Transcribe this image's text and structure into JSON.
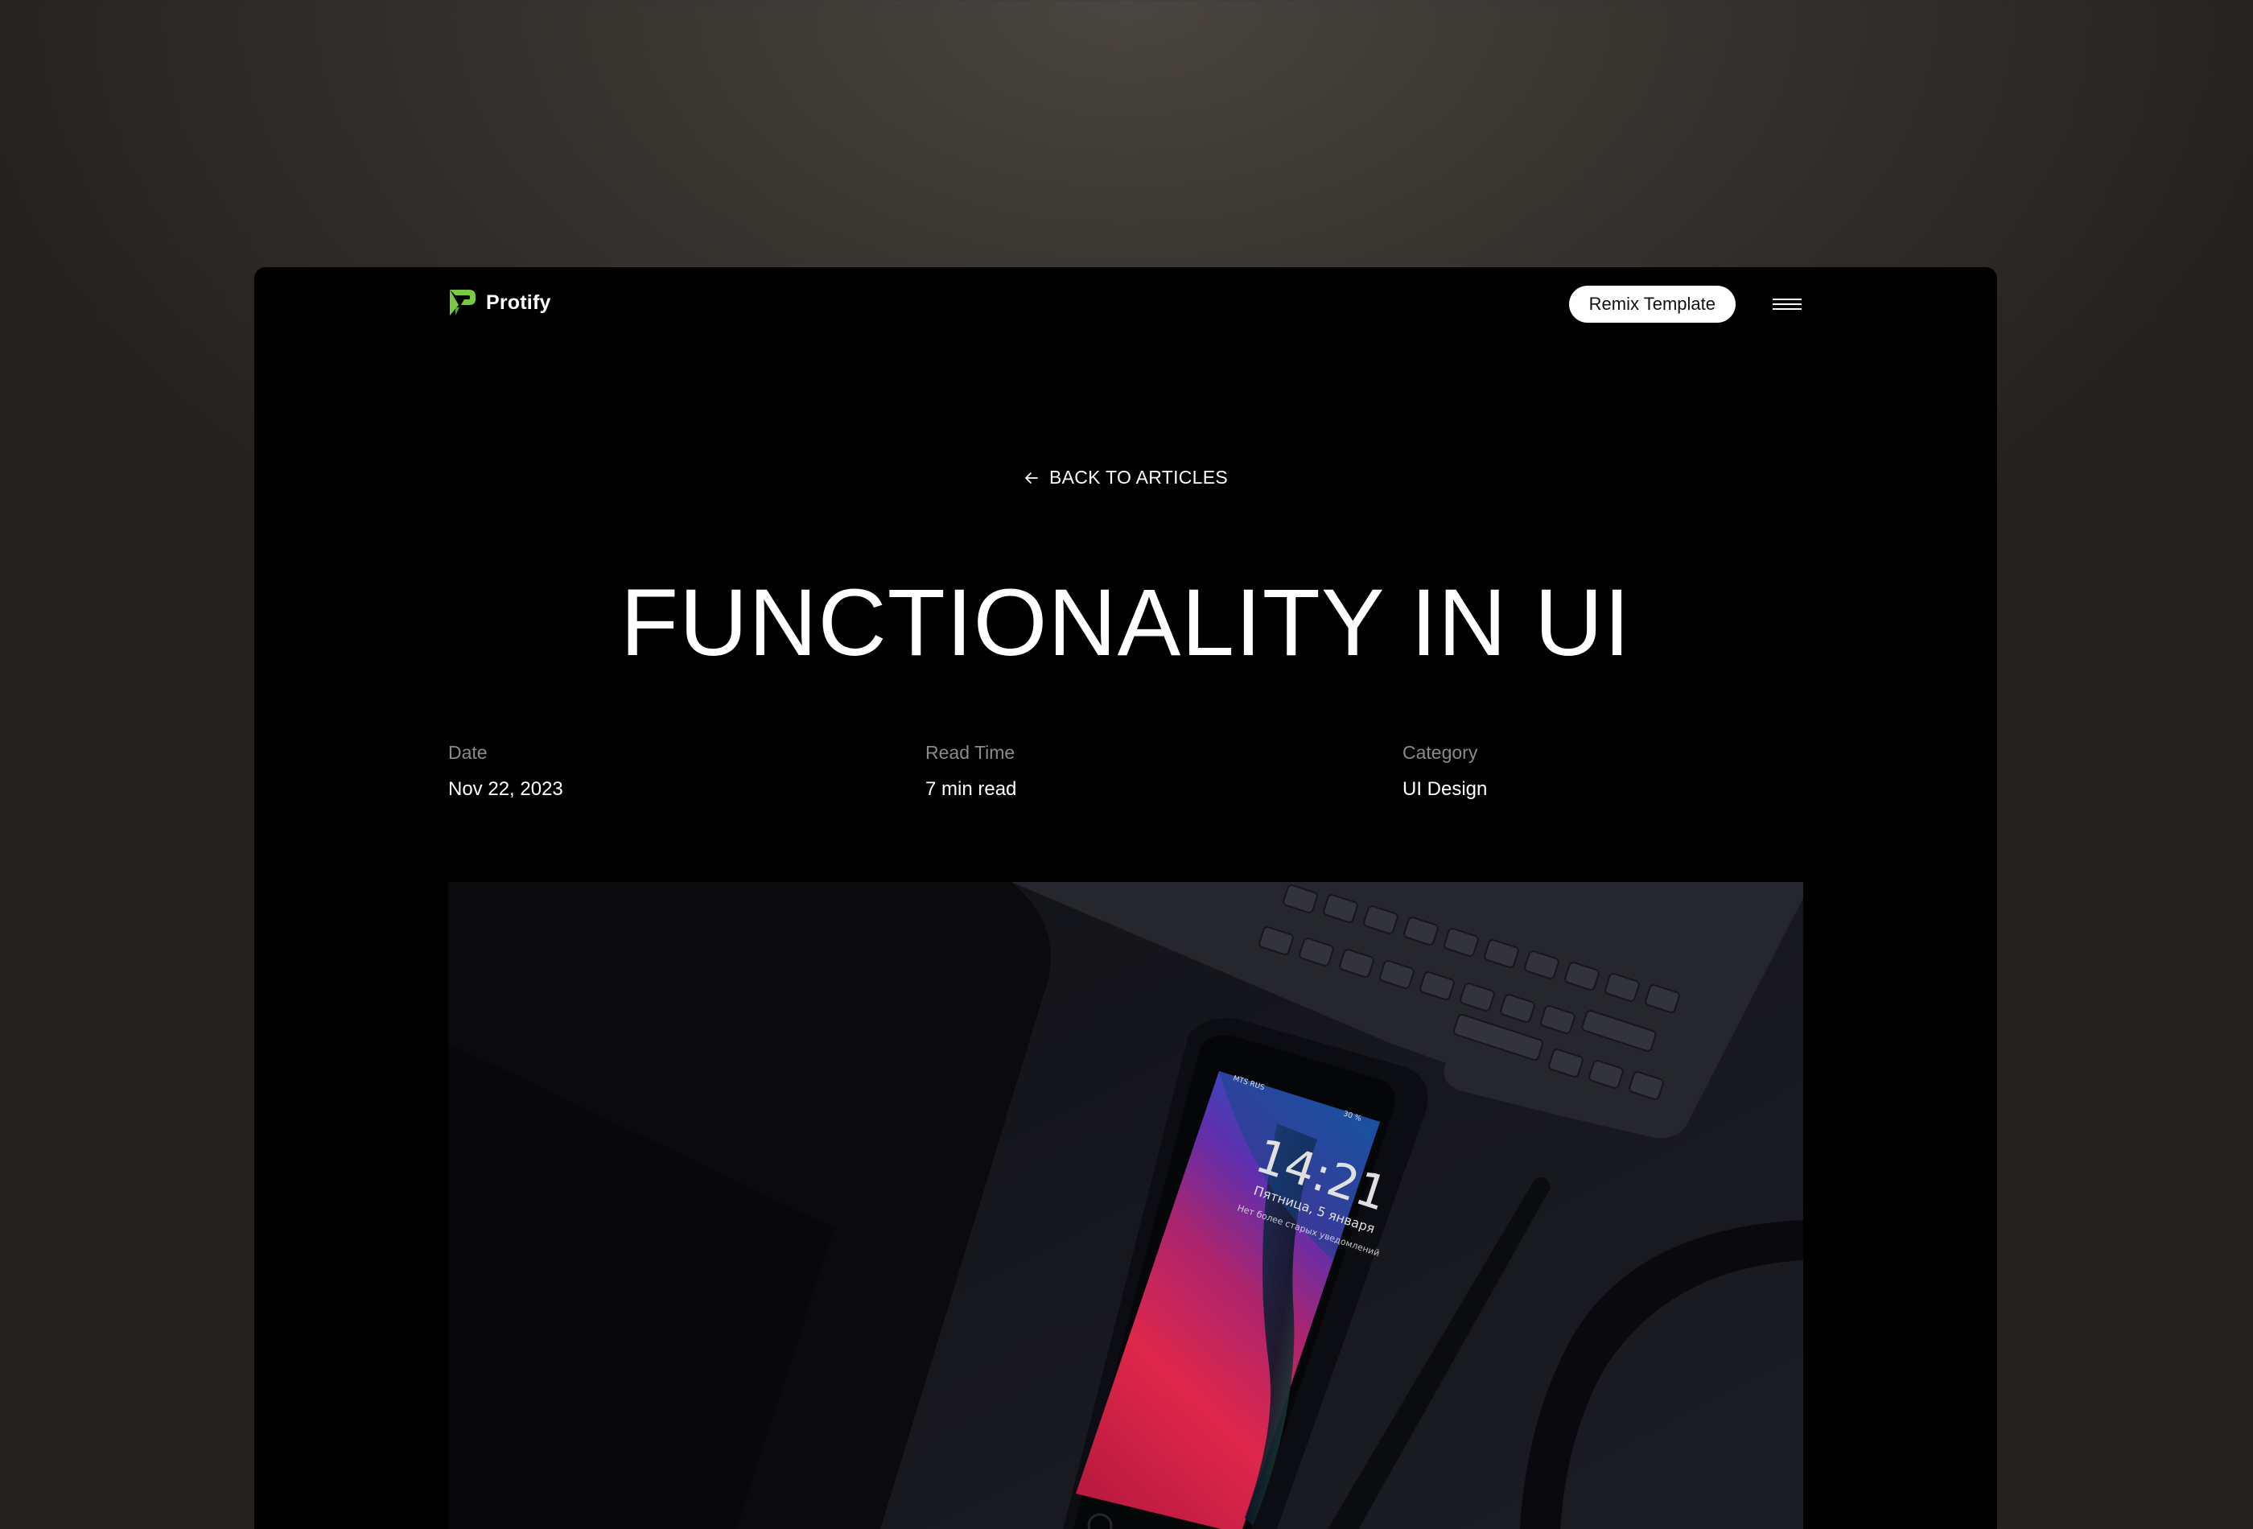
{
  "brand": {
    "name": "Protify",
    "accent": "#7ac943"
  },
  "nav": {
    "cta_label": "Remix Template",
    "menu_icon": "hamburger-icon"
  },
  "article": {
    "back_label": "BACK TO ARTICLES",
    "back_icon": "arrow-left-icon",
    "title": "FUNCTIONALITY IN UI",
    "meta": [
      {
        "label": "Date",
        "value": "Nov 22, 2023"
      },
      {
        "label": "Read Time",
        "value": "7 min read"
      },
      {
        "label": "Category",
        "value": "UI Design"
      }
    ]
  },
  "hero": {
    "phone_time": "14:21",
    "phone_date": "Пятница, 5 января",
    "phone_notice": "Нет более старых уведомлений",
    "phone_carrier": "MTS RUS",
    "phone_battery": "30 %"
  }
}
